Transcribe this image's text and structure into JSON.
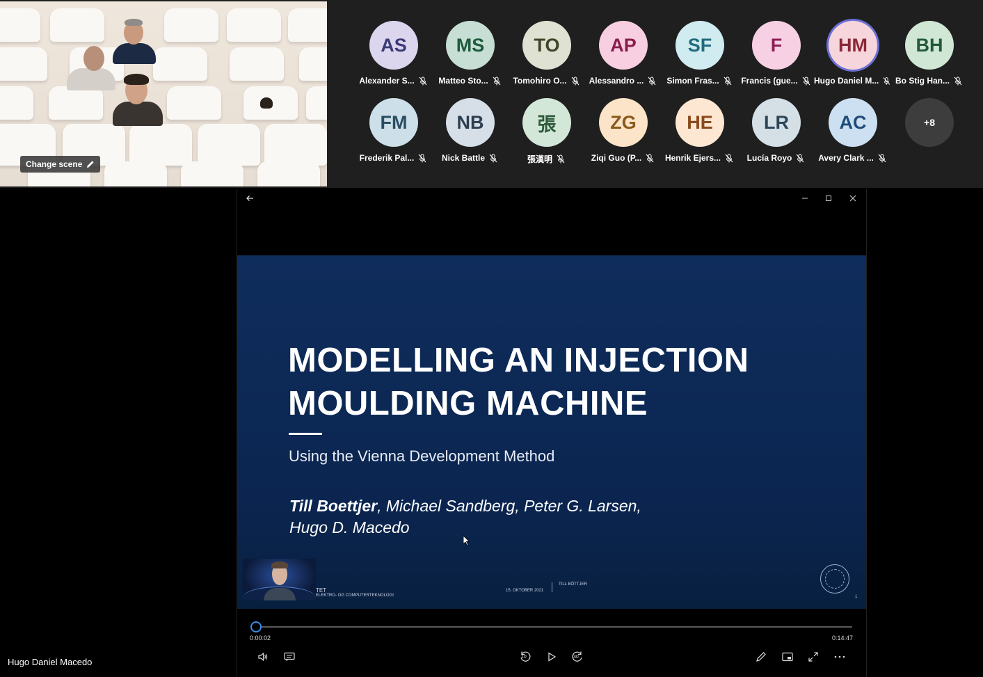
{
  "scene": {
    "change_scene_label": "Change scene"
  },
  "participants": [
    {
      "initials": "AS",
      "name": "Alexander S...",
      "bg": "#dbd6ee",
      "fg": "#3b3a78"
    },
    {
      "initials": "MS",
      "name": "Matteo Sto...",
      "bg": "#c6ded3",
      "fg": "#1d5a3c"
    },
    {
      "initials": "TO",
      "name": "Tomohiro O...",
      "bg": "#dfe2d2",
      "fg": "#3e4528"
    },
    {
      "initials": "AP",
      "name": "Alessandro ...",
      "bg": "#f7cfe0",
      "fg": "#8a1d4d"
    },
    {
      "initials": "SF",
      "name": "Simon Fras...",
      "bg": "#d0ecf0",
      "fg": "#226a7d"
    },
    {
      "initials": "F",
      "name": "Francis (gue...",
      "bg": "#f7d0e4",
      "fg": "#8e1f56"
    },
    {
      "initials": "HM",
      "name": "Hugo Daniel M...",
      "bg": "#f6d6dc",
      "fg": "#8b2838"
    },
    {
      "initials": "BH",
      "name": "Bo Stig Han...",
      "bg": "#cfe7d4",
      "fg": "#24593a"
    },
    {
      "initials": "FM",
      "name": "Frederik Pal...",
      "bg": "#cddfe8",
      "fg": "#2a4e63"
    },
    {
      "initials": "NB",
      "name": "Nick Battle",
      "bg": "#d6dfe7",
      "fg": "#2c3e50"
    },
    {
      "initials": "張",
      "name": "張漢明",
      "bg": "#d3e7d8",
      "fg": "#2f5a3c"
    },
    {
      "initials": "ZG",
      "name": "Ziqi Guo (P...",
      "bg": "#fbe4c7",
      "fg": "#8a5a1b"
    },
    {
      "initials": "HE",
      "name": "Henrik Ejers...",
      "bg": "#fde7d3",
      "fg": "#8b4a1c"
    },
    {
      "initials": "LR",
      "name": "Lucía Royo",
      "bg": "#d4dfe6",
      "fg": "#2d4658"
    },
    {
      "initials": "AC",
      "name": "Avery Clark ...",
      "bg": "#cde0f2",
      "fg": "#1f4d7a"
    }
  ],
  "overflow_count": "+8",
  "slide": {
    "title_line1": "MODELLING AN INJECTION",
    "title_line2": "MOULDING MACHINE",
    "subtitle": "Using the Vienna Development Method",
    "author_bold": "Till Boettjer",
    "authors_rest": ", Michael Sandberg, Peter G. Larsen,",
    "authors_line2": "Hugo D. Macedo",
    "footer_dept1": "TET",
    "footer_dept2": "ELEKTRO- OG COMPUTERTEKNOLOGI",
    "footer_date": "15. OKTOBER 2021",
    "footer_presenter": "TILL BÖTTJER",
    "footer_page": "1"
  },
  "player": {
    "current_time": "0:00:02",
    "total_time": "0:14:47",
    "progress_fraction": 0.002,
    "rewind_seconds": "10",
    "forward_seconds": "30"
  },
  "self_name": "Hugo Daniel Macedo",
  "colors": {
    "accent": "#3b8eea",
    "slide_bg": "#0f2d5c",
    "overflow_bg": "#3d3d3d"
  }
}
